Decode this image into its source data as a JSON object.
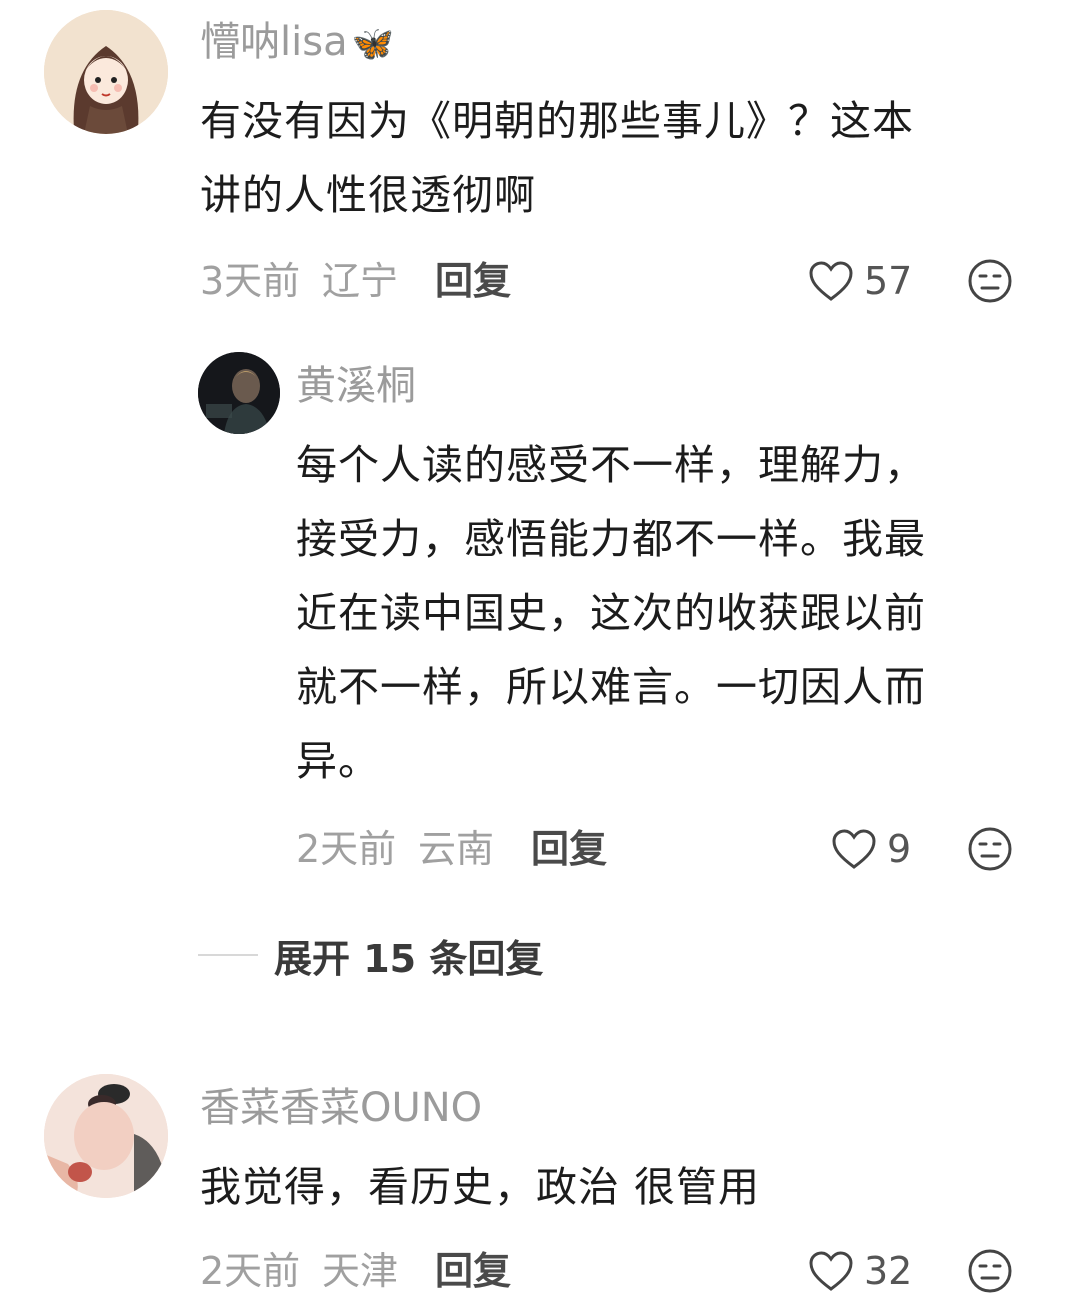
{
  "comments": [
    {
      "username": "懵呐lisa",
      "badge_emoji": "🦋",
      "content_lines": [
        "有没有因为《明朝的那些事儿》？这本",
        "讲的人性很透彻啊"
      ],
      "time": "3天前",
      "location": "辽宁",
      "reply_label": "回复",
      "likes": "57"
    },
    {
      "username": "黄溪桐",
      "content_lines": [
        "每个人读的感受不一样，理解力，",
        "接受力，感悟能力都不一样。我最",
        "近在读中国史，这次的收获跟以前",
        "就不一样，所以难言。一切因人而",
        "异。"
      ],
      "time": "2天前",
      "location": "云南",
      "reply_label": "回复",
      "likes": "9"
    },
    {
      "username": "香菜香菜OUNO",
      "content_lines": [
        "我觉得，看历史，政治 很管用"
      ],
      "time": "2天前",
      "location": "天津",
      "reply_label": "回复",
      "likes": "32"
    }
  ],
  "expand_replies_label": "展开 15 条回复",
  "icons": {
    "like": "heart-outline-icon",
    "dislike": "neutral-face-icon"
  },
  "colors": {
    "username": "#9b9b9b",
    "meta": "#a0a0a0",
    "text": "#1c1c1c"
  }
}
